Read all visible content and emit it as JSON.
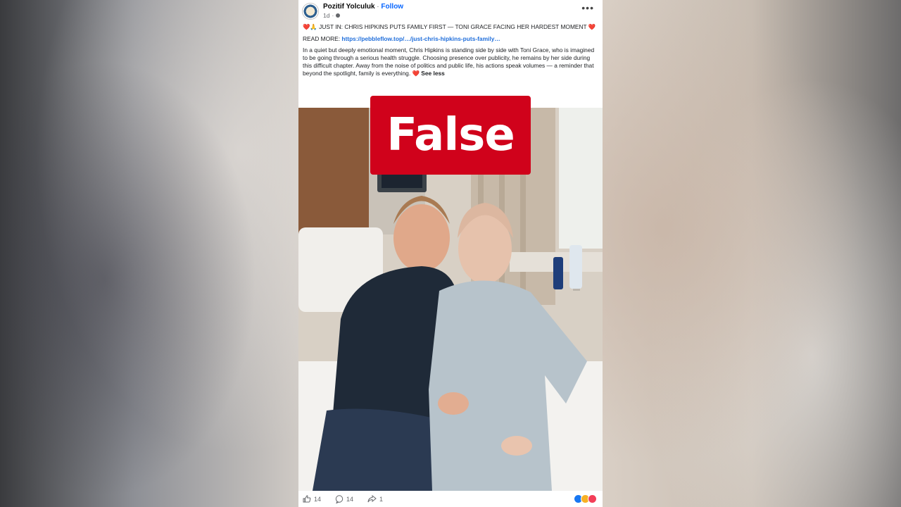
{
  "post": {
    "page_name": "Pozitif Yolculuk",
    "separator": " · ",
    "follow_label": "Follow",
    "time": "1d",
    "meta_separator": "·",
    "headline_prefix": "❤️🙏 JUST IN: CHRIS HIPKINS PUTS FAMILY FIRST — TONI GRACE FACING HER HARDEST MOMENT",
    "headline_suffix": " ❤️",
    "read_more_label": "READ MORE: ",
    "read_more_link": "https://pebbleflow.top/…/just-chris-hipkins-puts-family…",
    "body": "In a quiet but deeply emotional moment, Chris Hipkins is standing side by side with Toni Grace, who is imagined to be going through a serious health struggle. Choosing presence over publicity, he remains by her side during this difficult chapter. Away from the noise of politics and public life, his actions speak volumes — a reminder that beyond the spotlight, family is everything.",
    "body_heart": " ❤️ ",
    "see_less_label": "See less"
  },
  "fact_check": {
    "rating": "False",
    "color": "#d0021b"
  },
  "footer": {
    "likes_count": "14",
    "comments_count": "14",
    "shares_count": "1",
    "like_icon": "like-icon",
    "comment_icon": "comment-icon",
    "share_icon": "share-icon",
    "reaction_icons": [
      "like-reaction-icon",
      "care-reaction-icon",
      "love-reaction-icon"
    ]
  },
  "colors": {
    "follow_link": "#0866ff",
    "url_link": "#216fdb",
    "heart": "#e41e3f"
  }
}
